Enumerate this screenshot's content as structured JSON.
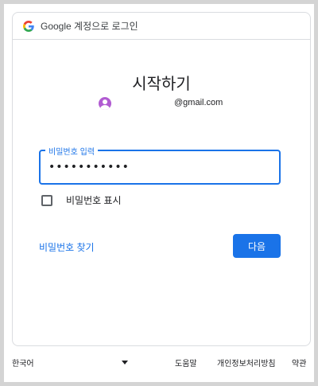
{
  "header": {
    "title": "Google 계정으로 로그인",
    "logo_icon": "google-g-icon"
  },
  "signin": {
    "heading": "시작하기",
    "account_email": "@gmail.com",
    "avatar_color": "#b15bd2"
  },
  "password_field": {
    "label": "비밀번호 입력",
    "value": "•••••••••••"
  },
  "show_password": {
    "label": "비밀번호 표시",
    "checked": false
  },
  "actions": {
    "forgot_link": "비밀번호 찾기",
    "next_button": "다음",
    "accent_color": "#1a73e8"
  },
  "footer": {
    "language": "한국어",
    "help": "도움말",
    "privacy": "개인정보처리방침",
    "terms": "약관"
  }
}
